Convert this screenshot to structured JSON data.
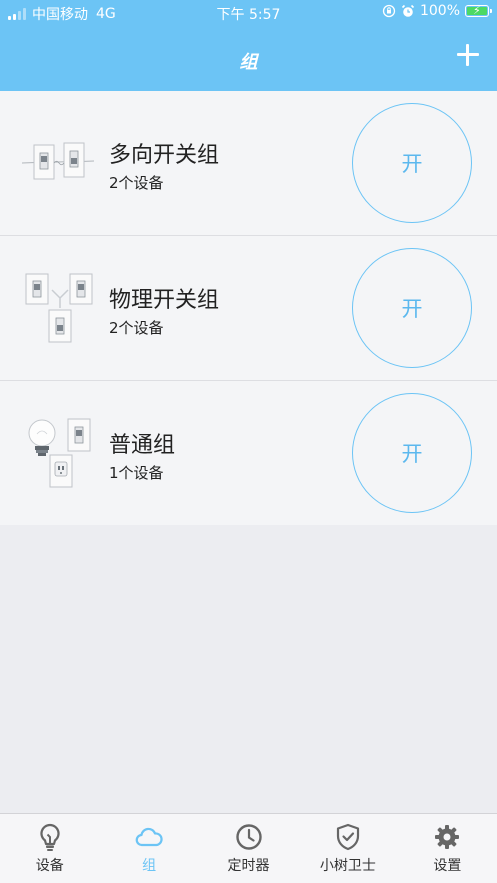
{
  "status_bar": {
    "carrier": "中国移动",
    "network": "4G",
    "time": "下午 5:57",
    "battery": "100%"
  },
  "nav": {
    "title": "组",
    "add_icon": "plus-icon"
  },
  "groups": [
    {
      "name": "多向开关组",
      "count": "2个设备",
      "button_label": "开",
      "thumb": "multi-way-switch-thumb"
    },
    {
      "name": "物理开关组",
      "count": "2个设备",
      "button_label": "开",
      "thumb": "physical-switch-thumb"
    },
    {
      "name": "普通组",
      "count": "1个设备",
      "button_label": "开",
      "thumb": "bulb-switch-socket-thumb"
    }
  ],
  "tabs": [
    {
      "label": "设备",
      "icon": "lightbulb-icon",
      "active": false
    },
    {
      "label": "组",
      "icon": "cloud-icon",
      "active": true
    },
    {
      "label": "定时器",
      "icon": "clock-icon",
      "active": false
    },
    {
      "label": "小树卫士",
      "icon": "shield-check-icon",
      "active": false
    },
    {
      "label": "设置",
      "icon": "gear-icon",
      "active": false
    }
  ],
  "colors": {
    "accent": "#6CC4F5",
    "background": "#ECEDF1",
    "row_background": "#F4F5F7",
    "battery_fill": "#4CD964"
  }
}
